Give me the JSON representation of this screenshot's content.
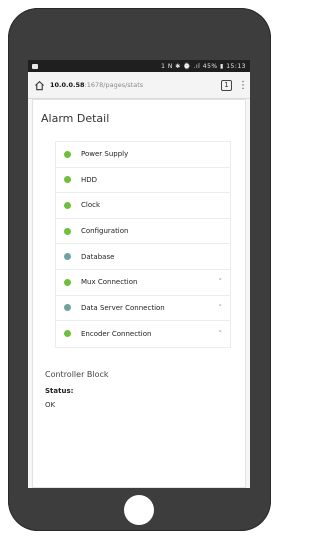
{
  "statusbar": {
    "right_text": "1 N ✱ ⌚ .ıl 45% ▮ 15:13"
  },
  "browser": {
    "url_host": "10.0.0.58",
    "url_path": ":1678/pages/stats",
    "tab_count": "1"
  },
  "page": {
    "title": "Alarm Detail",
    "items": [
      {
        "label": "Power Supply",
        "color": "#6fbf3b",
        "expandable": false
      },
      {
        "label": "HDD",
        "color": "#6fbf3b",
        "expandable": false
      },
      {
        "label": "Clock",
        "color": "#6fbf3b",
        "expandable": false
      },
      {
        "label": "Configuration",
        "color": "#6fbf3b",
        "expandable": false
      },
      {
        "label": "Database",
        "color": "#6fa3a0",
        "expandable": false
      },
      {
        "label": "Mux Connection",
        "color": "#6fbf3b",
        "expandable": true
      },
      {
        "label": "Data Server Connection",
        "color": "#6fa3a0",
        "expandable": true
      },
      {
        "label": "Encoder Connection",
        "color": "#6fbf3b",
        "expandable": true
      }
    ],
    "chevron": "˅",
    "block": {
      "title": "Controller Block",
      "status_label": "Status:",
      "status_value": "OK"
    }
  }
}
